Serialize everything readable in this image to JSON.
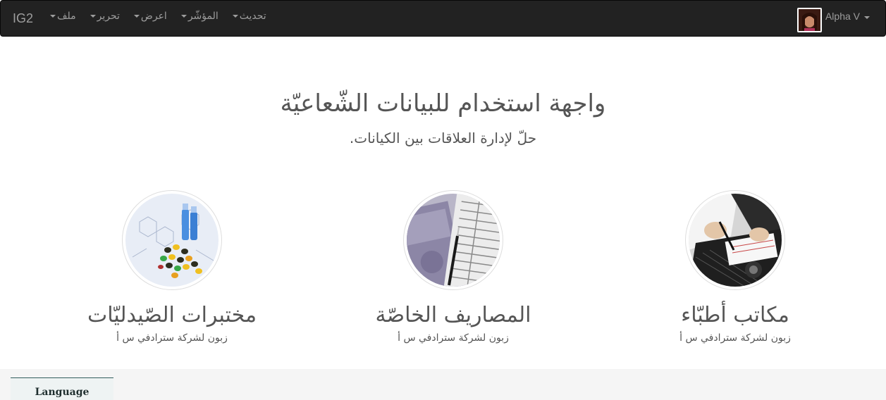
{
  "navbar": {
    "brand": "IG2",
    "menu": [
      {
        "label": "ملف"
      },
      {
        "label": "تحرير"
      },
      {
        "label": "اعرض"
      },
      {
        "label": "المؤشّر"
      },
      {
        "label": "تحديث"
      }
    ],
    "user_name": "Alpha V"
  },
  "hero": {
    "title": "واجهة استخدام للبيانات الشّعاعيّة",
    "subtitle": "حلّ لإدارة العلاقات بين الكيانات."
  },
  "cards": [
    {
      "title": "مختبرات الصّيدليّات",
      "subtitle": "زبون لشركة سترادفي س أ",
      "icon": "pharmacy-lab-image"
    },
    {
      "title": "المصاريف الخاصّة",
      "subtitle": "زبون لشركة سترادفي س أ",
      "icon": "private-expenses-image"
    },
    {
      "title": "مكاتب أطبّاء",
      "subtitle": "زبون لشركة سترادفي س أ",
      "icon": "doctors-office-image"
    }
  ],
  "footer": {
    "language_label": "Language"
  },
  "colors": {
    "navbar_bg": "#222222",
    "navbar_text": "#9d9d9d",
    "text": "#555555",
    "footer_bg": "#f5f5f5"
  }
}
